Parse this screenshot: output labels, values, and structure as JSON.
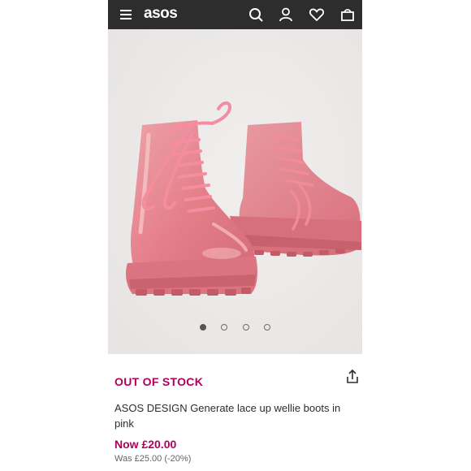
{
  "header": {
    "brand": "asos",
    "icons": [
      "menu-icon",
      "search-icon",
      "account-icon",
      "wishlist-heart-icon",
      "bag-icon"
    ]
  },
  "gallery": {
    "image_subject": "Pink lace-up wellie boots",
    "total_images": 4,
    "active_index": 0
  },
  "product": {
    "stock_status": "OUT OF STOCK",
    "name": "ASOS DESIGN Generate lace up wellie boots in pink",
    "price_now": "Now £20.00",
    "price_was": "Was £25.00 (-20%)"
  },
  "colors": {
    "header_bg": "#2d2d2d",
    "accent": "#b0005c",
    "boot_pink": "#e7868f",
    "image_bg": "#ebe8e7"
  }
}
